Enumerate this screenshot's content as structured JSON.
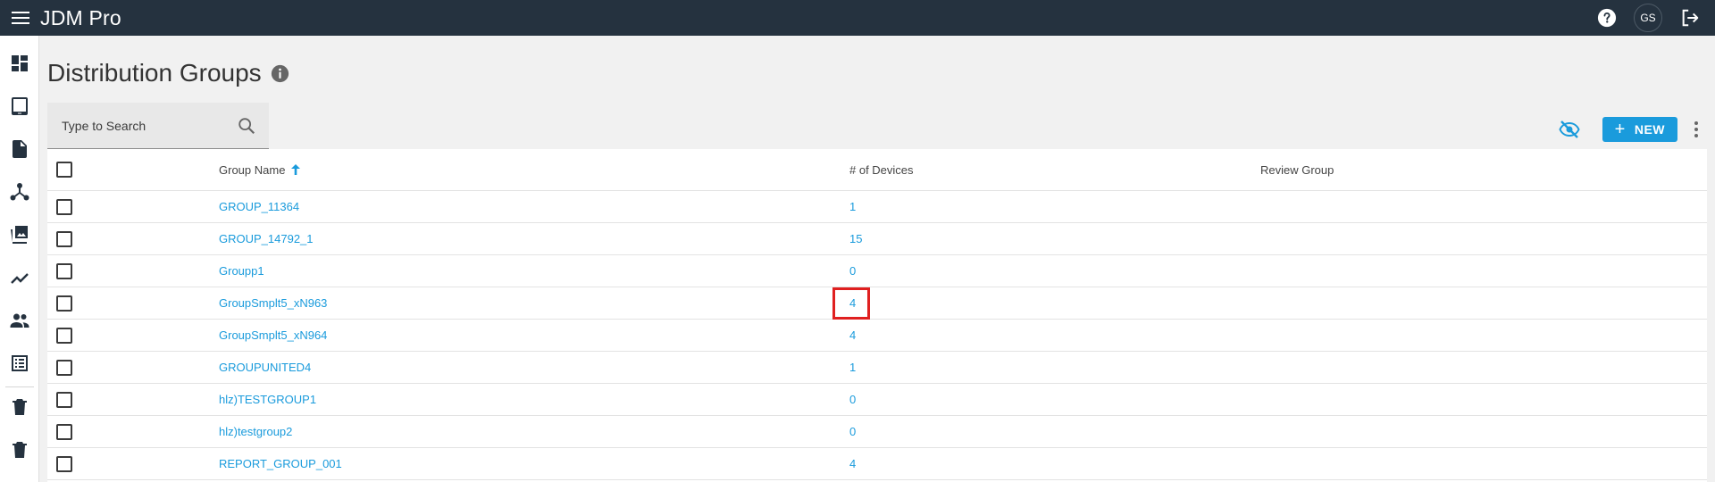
{
  "app": {
    "title": "JDM Pro"
  },
  "topbar": {
    "avatar_initials": "GS"
  },
  "icons": {
    "menu": "hamburger-menu-icon",
    "help": "help-icon",
    "logout": "logout-icon",
    "info": "info-icon",
    "search": "search-icon",
    "hide": "visibility-off-icon",
    "more": "more-vert-icon",
    "sort": "arrow-up-icon"
  },
  "sidebar": {
    "items": [
      {
        "name": "dashboard",
        "icon": "dashboard-icon"
      },
      {
        "name": "devices",
        "icon": "tablet-icon"
      },
      {
        "name": "documents",
        "icon": "document-icon"
      },
      {
        "name": "groups",
        "icon": "hierarchy-icon"
      },
      {
        "name": "media",
        "icon": "photo-library-icon"
      },
      {
        "name": "analytics",
        "icon": "trending-up-icon"
      },
      {
        "name": "users",
        "icon": "people-icon"
      },
      {
        "name": "lists",
        "icon": "list-alt-icon"
      },
      {
        "name": "trash-1",
        "icon": "trash-icon"
      },
      {
        "name": "trash-2",
        "icon": "trash-icon"
      }
    ]
  },
  "page": {
    "title": "Distribution Groups"
  },
  "search": {
    "placeholder": "Type to Search",
    "value": ""
  },
  "toolbar": {
    "new_label": "NEW",
    "new_plus": "+"
  },
  "table": {
    "columns": {
      "name": "Group Name",
      "devices": "# of Devices",
      "review": "Review Group"
    },
    "rows": [
      {
        "name": "GROUP_11364",
        "devices": "1",
        "review": ""
      },
      {
        "name": "GROUP_14792_1",
        "devices": "15",
        "review": ""
      },
      {
        "name": "Groupp1",
        "devices": "0",
        "review": ""
      },
      {
        "name": "GroupSmplt5_xN963",
        "devices": "4",
        "review": ""
      },
      {
        "name": "GroupSmplt5_xN964",
        "devices": "4",
        "review": ""
      },
      {
        "name": "GROUPUNITED4",
        "devices": "1",
        "review": ""
      },
      {
        "name": "hlz)TESTGROUP1",
        "devices": "0",
        "review": ""
      },
      {
        "name": "hlz)testgroup2",
        "devices": "0",
        "review": ""
      },
      {
        "name": "REPORT_GROUP_001",
        "devices": "4",
        "review": ""
      }
    ]
  },
  "colors": {
    "topbar": "#25323f",
    "accent": "#1a9bdc",
    "highlight": "#e02020"
  }
}
